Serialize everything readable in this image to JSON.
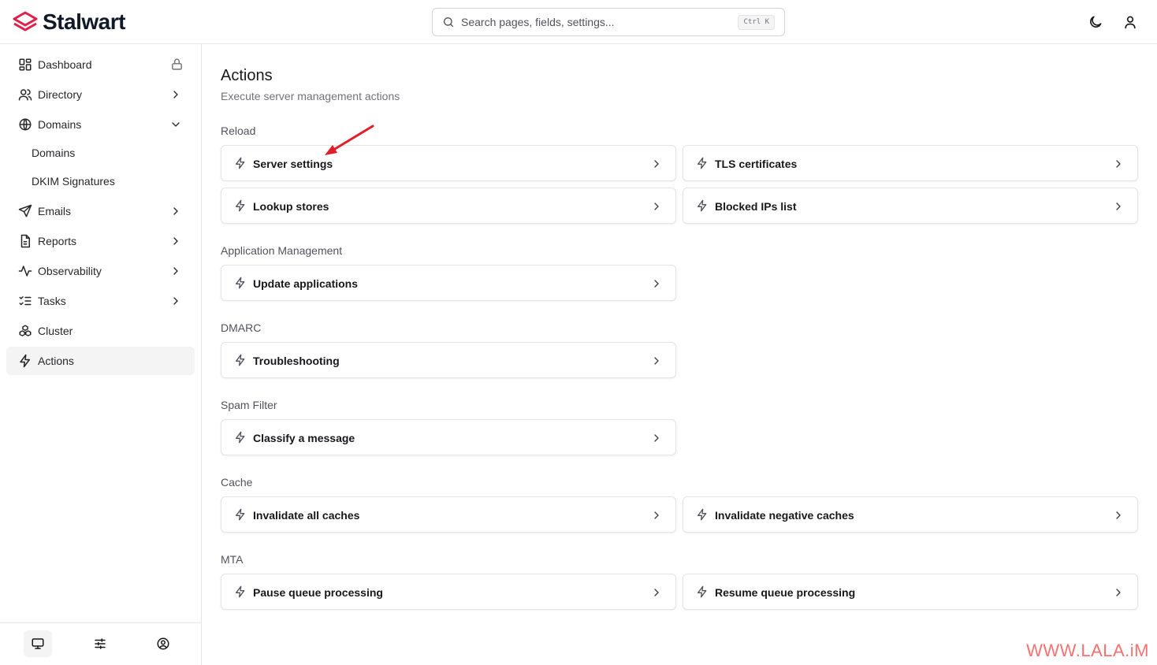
{
  "app": {
    "name": "Stalwart",
    "brand_color": "#e11d48",
    "accent": "#111827"
  },
  "search": {
    "placeholder": "Search pages, fields, settings...",
    "shortcut": "Ctrl K"
  },
  "topbar": {
    "theme_icon": "moon-icon",
    "user_icon": "user-icon"
  },
  "sidebar": {
    "items": [
      {
        "label": "Dashboard",
        "icon": "dashboard-icon",
        "trailing": "lock"
      },
      {
        "label": "Directory",
        "icon": "users-icon",
        "trailing": "chevron-right"
      },
      {
        "label": "Domains",
        "icon": "globe-icon",
        "trailing": "chevron-down"
      },
      {
        "label": "Domains",
        "sub": true
      },
      {
        "label": "DKIM Signatures",
        "sub": true
      },
      {
        "label": "Emails",
        "icon": "send-icon",
        "trailing": "chevron-right"
      },
      {
        "label": "Reports",
        "icon": "file-icon",
        "trailing": "chevron-right"
      },
      {
        "label": "Observability",
        "icon": "activity-icon",
        "trailing": "chevron-right"
      },
      {
        "label": "Tasks",
        "icon": "list-checks-icon",
        "trailing": "chevron-right"
      },
      {
        "label": "Cluster",
        "icon": "boxes-icon",
        "trailing": ""
      },
      {
        "label": "Actions",
        "icon": "zap-icon",
        "trailing": "",
        "active": true
      }
    ],
    "footer": [
      "monitor-icon",
      "sliders-icon",
      "user-circle-icon"
    ]
  },
  "page": {
    "title": "Actions",
    "subtitle": "Execute server management actions",
    "sections": [
      {
        "label": "Reload",
        "actions": [
          "Server settings",
          "TLS certificates",
          "Lookup stores",
          "Blocked IPs list"
        ]
      },
      {
        "label": "Application Management",
        "actions": [
          "Update applications"
        ]
      },
      {
        "label": "DMARC",
        "actions": [
          "Troubleshooting"
        ]
      },
      {
        "label": "Spam Filter",
        "actions": [
          "Classify a message"
        ]
      },
      {
        "label": "Cache",
        "actions": [
          "Invalidate all caches",
          "Invalidate negative caches"
        ]
      },
      {
        "label": "MTA",
        "actions": [
          "Pause queue processing",
          "Resume queue processing"
        ]
      }
    ]
  },
  "annotation": {
    "color": "#e11d2a"
  },
  "watermark": "WWW.LALA.iM"
}
